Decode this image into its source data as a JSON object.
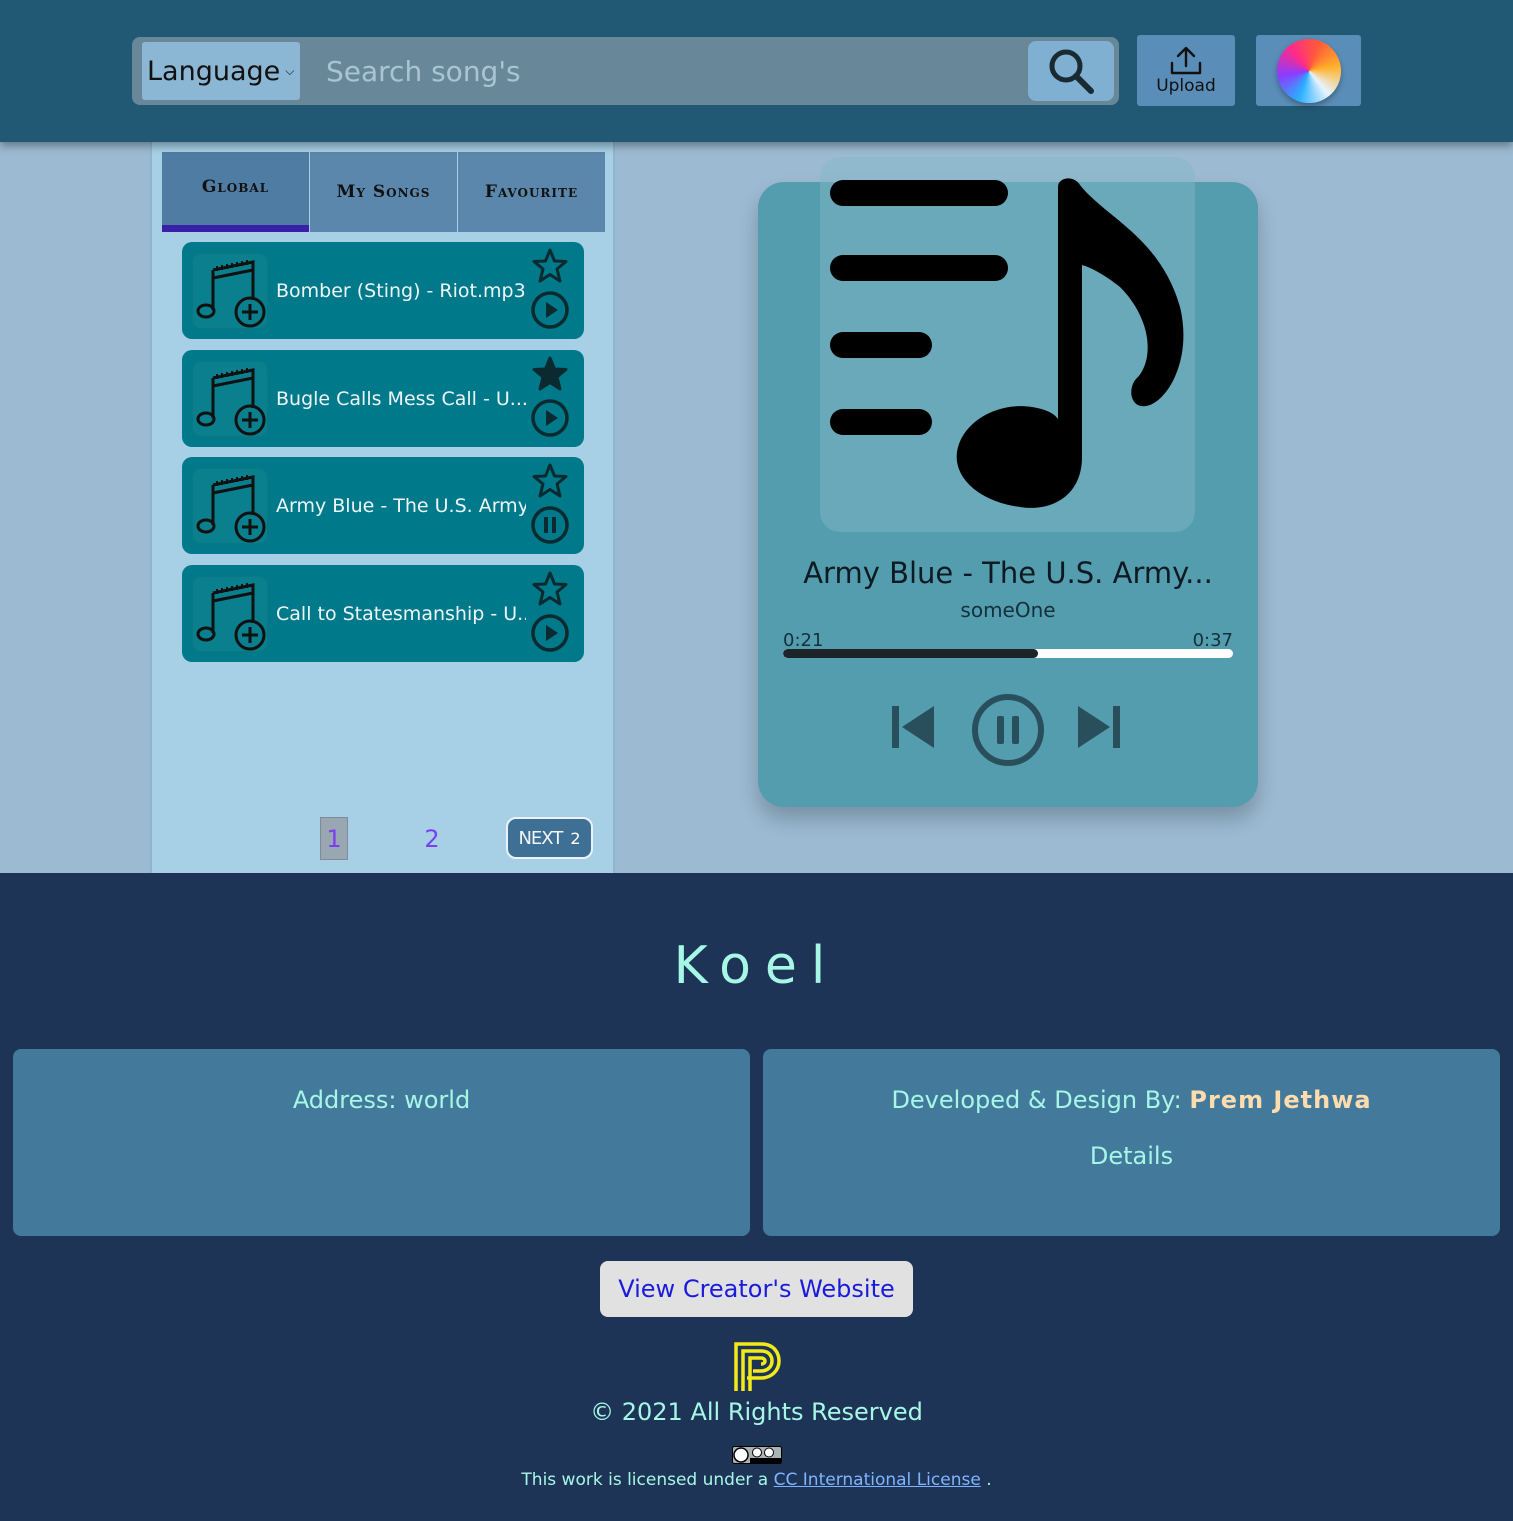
{
  "header": {
    "language_label": "Language",
    "search_placeholder": "Search song's",
    "upload_label": "Upload"
  },
  "tabs": [
    {
      "label": "Global",
      "active": true
    },
    {
      "label": "My Songs",
      "active": false
    },
    {
      "label": "Favourite",
      "active": false
    }
  ],
  "songs": [
    {
      "title": "Bomber (Sting) - Riot.mp3",
      "favourite": false,
      "state": "play"
    },
    {
      "title": "Bugle Calls Mess Call - U...",
      "favourite": true,
      "state": "play"
    },
    {
      "title": "Army Blue - The U.S. Army...",
      "favourite": false,
      "state": "pause"
    },
    {
      "title": "Call to Statesmanship - U...",
      "favourite": false,
      "state": "play"
    }
  ],
  "pagination": {
    "pages": [
      "1",
      "2"
    ],
    "current": "1",
    "next_label": "NEXT",
    "next_page": "2"
  },
  "player": {
    "title": "Army Blue - The U.S. Army...",
    "artist": "someOne",
    "current_time": "0:21",
    "duration": "0:37",
    "progress": 0.567
  },
  "footer": {
    "brand": "Koel",
    "address": "Address: world",
    "developed_by_label": "Developed & Design By:",
    "developer_name": "Prem Jethwa",
    "details_label": "Details",
    "creator_button": "View Creator's Website",
    "copyright": "© 2021 All Rights Reserved",
    "license_prefix": "This work is licensed under a",
    "license_link": "CC International License",
    "license_suffix": "."
  },
  "colors": {
    "header_bg": "#215873",
    "song_card": "#00798a",
    "player_bg": "#549dae",
    "footer_bg": "#1e3457",
    "accent_text": "#a7f7e6",
    "tab_active_indicator": "#3a1fa8"
  }
}
